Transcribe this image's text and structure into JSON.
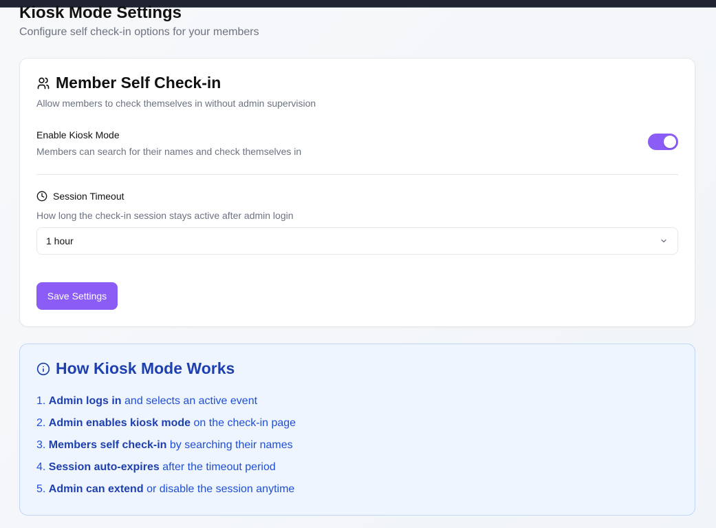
{
  "header": {
    "title": "Kiosk Mode Settings",
    "subtitle": "Configure self check-in options for your members"
  },
  "settings_card": {
    "icon": "users-icon",
    "title": "Member Self Check-in",
    "description": "Allow members to check themselves in without admin supervision",
    "kiosk": {
      "label": "Enable Kiosk Mode",
      "help": "Members can search for their names and check themselves in",
      "enabled": true
    },
    "timeout": {
      "icon": "clock-icon",
      "label": "Session Timeout",
      "help": "How long the check-in session stays active after admin login",
      "selected": "1 hour"
    },
    "save_label": "Save Settings"
  },
  "info_card": {
    "icon": "info-icon",
    "title": "How Kiosk Mode Works",
    "steps": [
      {
        "num": "1.",
        "strong": "Admin logs in",
        "rest": "and selects an active event"
      },
      {
        "num": "2.",
        "strong": "Admin enables kiosk mode",
        "rest": "on the check-in page"
      },
      {
        "num": "3.",
        "strong": "Members self check-in",
        "rest": "by searching their names"
      },
      {
        "num": "4.",
        "strong": "Session auto-expires",
        "rest": "after the timeout period"
      },
      {
        "num": "5.",
        "strong": "Admin can extend",
        "rest": "or disable the session anytime"
      }
    ]
  },
  "colors": {
    "accent": "#8b5cf6",
    "info_bg": "#eff5ff",
    "info_text": "#1e40af"
  }
}
